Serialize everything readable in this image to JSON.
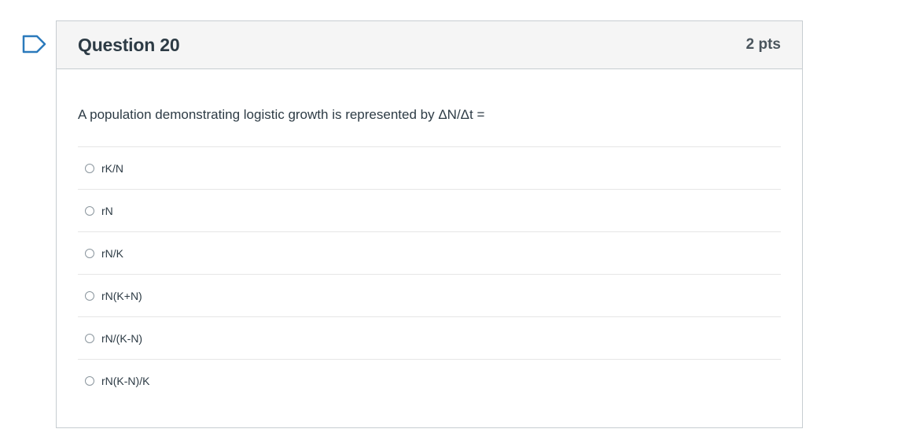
{
  "question": {
    "title": "Question 20",
    "points": "2 pts",
    "text": "A population demonstrating logistic growth is represented by ΔN/Δt =",
    "flag_icon": "flag-outline-icon",
    "answers": [
      {
        "label": "rK/N"
      },
      {
        "label": "rN"
      },
      {
        "label": "rN/K"
      },
      {
        "label": "rN(K+N)"
      },
      {
        "label": "rN/(K-N)"
      },
      {
        "label": "rN(K-N)/K"
      }
    ]
  },
  "colors": {
    "border": "#c7cdd1",
    "header_bg": "#f5f5f5",
    "flag": "#2b7abc",
    "text": "#2d3b45"
  }
}
